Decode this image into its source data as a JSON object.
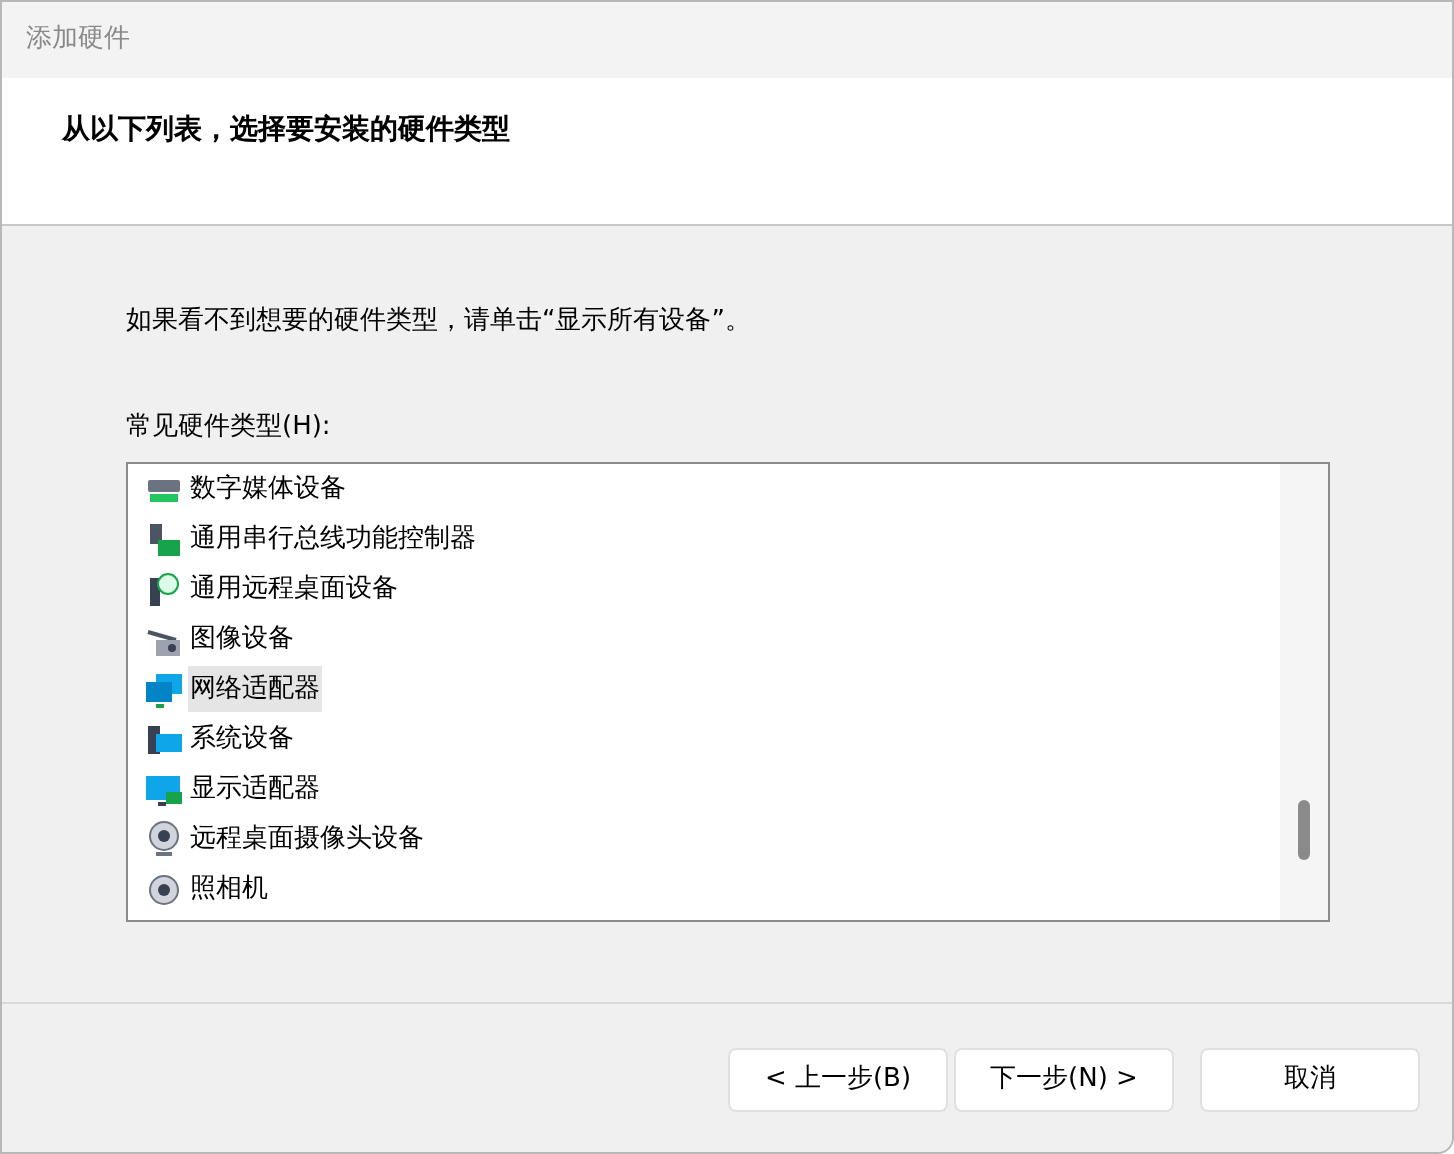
{
  "window": {
    "title": "添加硬件"
  },
  "header": {
    "heading": "从以下列表，选择要安装的硬件类型"
  },
  "instruction": "如果看不到想要的硬件类型，请单击“显示所有设备”。",
  "list": {
    "label": "常见硬件类型(H):",
    "items": [
      {
        "label": "数字媒体设备",
        "selected": false
      },
      {
        "label": "通用串行总线功能控制器",
        "selected": false
      },
      {
        "label": "通用远程桌面设备",
        "selected": false
      },
      {
        "label": "图像设备",
        "selected": false
      },
      {
        "label": "网络适配器",
        "selected": true
      },
      {
        "label": "系统设备",
        "selected": false
      },
      {
        "label": "显示适配器",
        "selected": false
      },
      {
        "label": "远程桌面摄像头设备",
        "selected": false
      },
      {
        "label": "照相机",
        "selected": false
      }
    ]
  },
  "buttons": [
    {
      "label": "< 上一步(B)"
    },
    {
      "label": "下一步(N) >"
    },
    {
      "label": "取消"
    }
  ]
}
